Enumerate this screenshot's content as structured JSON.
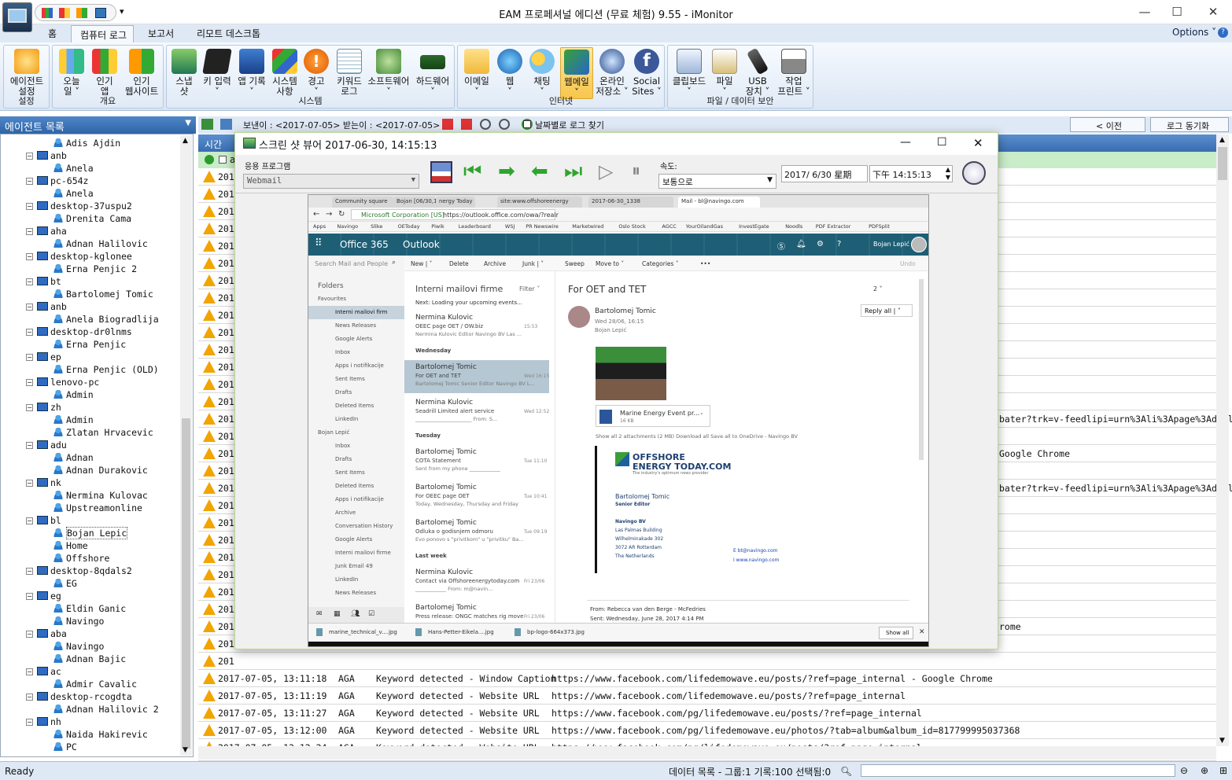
{
  "app": {
    "title": "EAM 프로페셔널 에디션 (무료 체험) 9.55 - iMonitor"
  },
  "window_controls": {
    "minimize": "—",
    "maximize": "☐",
    "close": "✕"
  },
  "ribbon_tabs": [
    "홈",
    "컴퓨터 로그",
    "보고서",
    "리모트 데스크톱"
  ],
  "options": "Options ˅",
  "groups": [
    {
      "label": "설정",
      "buttons": [
        "에이전트\n설정"
      ]
    },
    {
      "label": "개요",
      "buttons": [
        "오늘\n일 ˅",
        "인기\n앱",
        "인기\n웹사이트"
      ]
    },
    {
      "label": "시스템",
      "buttons": [
        "스냅\n샷",
        "키 입력\n˅",
        "앱 기록\n˅",
        "시스템\n사항",
        "경고\n˅",
        "키워드\n로그",
        "소프트웨어\n˅",
        "하드웨어\n˅"
      ]
    },
    {
      "label": "인터넷",
      "buttons": [
        "이메일\n˅",
        "웹\n˅",
        "채팅\n˅",
        "웹메일\n˅",
        "온라인\n저장소 ˅",
        "Social\nSites ˅"
      ]
    },
    {
      "label": "파일 / 데이터 보안",
      "buttons": [
        "클립보드\n˅",
        "파일\n˅",
        "USB\n장치 ˅",
        "작업\n프린트 ˅"
      ]
    }
  ],
  "agent_list": {
    "title": "에이전트 목록"
  },
  "tree": [
    {
      "t": "Adis Ajdin",
      "l": 2
    },
    {
      "t": "anb",
      "l": 1
    },
    {
      "t": "Anela",
      "l": 2
    },
    {
      "t": "pc-654z",
      "l": 1
    },
    {
      "t": "Anela",
      "l": 2
    },
    {
      "t": "desktop-37uspu2",
      "l": 1
    },
    {
      "t": "Drenita Cama",
      "l": 2
    },
    {
      "t": "aha",
      "l": 1
    },
    {
      "t": "Adnan Halilovic",
      "l": 2
    },
    {
      "t": "desktop-kglonee",
      "l": 1
    },
    {
      "t": "Erna Penjic 2",
      "l": 2
    },
    {
      "t": "bt",
      "l": 1
    },
    {
      "t": "Bartolomej Tomic",
      "l": 2
    },
    {
      "t": "anb",
      "l": 1
    },
    {
      "t": "Anela Biogradlija",
      "l": 2
    },
    {
      "t": "desktop-dr0lnms",
      "l": 1
    },
    {
      "t": "Erna Penjic",
      "l": 2
    },
    {
      "t": "ep",
      "l": 1
    },
    {
      "t": "Erna Penjic (OLD)",
      "l": 2
    },
    {
      "t": "lenovo-pc",
      "l": 1
    },
    {
      "t": "Admin",
      "l": 2
    },
    {
      "t": "zh",
      "l": 1
    },
    {
      "t": "Admin",
      "l": 2
    },
    {
      "t": "Zlatan Hrvacevic",
      "l": 2
    },
    {
      "t": "adu",
      "l": 1
    },
    {
      "t": "Adnan",
      "l": 2
    },
    {
      "t": "Adnan Durakovic",
      "l": 2
    },
    {
      "t": "nk",
      "l": 1
    },
    {
      "t": "Nermina Kulovac",
      "l": 2
    },
    {
      "t": "Upstreamonline",
      "l": 2
    },
    {
      "t": "bl",
      "l": 1
    },
    {
      "t": "Bojan Lepic",
      "l": 2
    },
    {
      "t": "Home",
      "l": 2
    },
    {
      "t": "Offshore",
      "l": 2
    },
    {
      "t": "desktop-8qdals2",
      "l": 1
    },
    {
      "t": "EG",
      "l": 2
    },
    {
      "t": "eg",
      "l": 1
    },
    {
      "t": "Eldin Ganic",
      "l": 2
    },
    {
      "t": "Navingo",
      "l": 2
    },
    {
      "t": "aba",
      "l": 1
    },
    {
      "t": "Navingo",
      "l": 2
    },
    {
      "t": "Adnan Bajic",
      "l": 2
    },
    {
      "t": "ac",
      "l": 1
    },
    {
      "t": "Admir Cavalic",
      "l": 2
    },
    {
      "t": "desktop-rcogdta",
      "l": 1
    },
    {
      "t": "Adnan Halilovic 2",
      "l": 2
    },
    {
      "t": "nh",
      "l": 1
    },
    {
      "t": "Naida Hakirevic",
      "l": 2
    },
    {
      "t": "PC",
      "l": 2
    }
  ],
  "toolbar2": {
    "range": "보낸이 : <2017-07-05> 받는이 : <2017-07-05>",
    "find_by_date": "날짜별로 로그 찾기",
    "prev": "< 이전",
    "sync": "로그 동기화"
  },
  "grid": {
    "time_header": "시간",
    "green_row": "a"
  },
  "partial_rows": [
    {
      "d": "201"
    },
    {
      "d": "201"
    },
    {
      "d": "201"
    },
    {
      "d": "201"
    },
    {
      "d": "201"
    },
    {
      "d": "201"
    },
    {
      "d": "201"
    },
    {
      "d": "201"
    },
    {
      "d": "201"
    },
    {
      "d": "201"
    },
    {
      "d": "201"
    },
    {
      "d": "201"
    },
    {
      "d": "201"
    },
    {
      "d": "201"
    },
    {
      "d": "201",
      "r": "bater?trk=v-feedlipi=urn%3Ali%3Apage%3Ad_flagsl"
    },
    {
      "d": "201"
    },
    {
      "d": "201",
      "r": "Google Chrome"
    },
    {
      "d": "201"
    },
    {
      "d": "201",
      "r": "bater?trk=v-feedlipi=urn%3Ali%3Apage%3Ad_flagsl"
    },
    {
      "d": "201"
    },
    {
      "d": "201"
    },
    {
      "d": "201"
    },
    {
      "d": "201"
    },
    {
      "d": "201"
    },
    {
      "d": "201"
    },
    {
      "d": "201"
    },
    {
      "d": "201",
      "r": "rome"
    },
    {
      "d": "201"
    },
    {
      "d": "201"
    }
  ],
  "rows": [
    {
      "time": "2017-07-05, 13:11:18",
      "user": "AGA",
      "type": "Keyword detected - Window Caption",
      "detail": "https://www.facebook.com/lifedemowave.eu/posts/?ref=page_internal - Google Chrome"
    },
    {
      "time": "2017-07-05, 13:11:19",
      "user": "AGA",
      "type": "Keyword detected - Website URL",
      "detail": "https://www.facebook.com/lifedemowave.eu/posts/?ref=page_internal"
    },
    {
      "time": "2017-07-05, 13:11:27",
      "user": "AGA",
      "type": "Keyword detected - Website URL",
      "detail": "https://www.facebook.com/pg/lifedemowave.eu/posts/?ref=page_internal"
    },
    {
      "time": "2017-07-05, 13:12:00",
      "user": "AGA",
      "type": "Keyword detected - Website URL",
      "detail": "https://www.facebook.com/pg/lifedemowave.eu/photos/?tab=album&album_id=817799995037368"
    },
    {
      "time": "2017-07-05, 13:12:24",
      "user": "AGA",
      "type": "Keyword detected - Website URL",
      "detail": "https://www.facebook.com/pg/lifedemowave.eu/posts/?ref=page_internal"
    }
  ],
  "status": {
    "left": "Ready",
    "right": "데이터 목록 - 그룹:1 기록:100 선택됨:0"
  },
  "viewer": {
    "title": "스크린 샷 뷰어 2017-06-30, 14:15:13",
    "app_label": "응용 프로그램",
    "app_value": "Webmail",
    "speed_label": "속도:",
    "speed_value": "보통으로",
    "date": "2017/ 6/30 星期",
    "time": "下午 14:15:13"
  },
  "shot": {
    "tabs": [
      "Community square",
      "Bojan [06/30,14:15:13]",
      "nergy Today",
      "site:www.offshoreenergy",
      "2017-06-30_1338",
      "Mail - bl@navingo.com"
    ],
    "url": "https://outlook.office.com/owa/?realr",
    "corp": "Microsoft Corporation [US]",
    "bookmarks": [
      "Apps",
      "Navingo",
      "Slike",
      "OEToday",
      "Piwik",
      "Leaderboard",
      "WSJ",
      "PR Newswire",
      "Marketwired",
      "Oslo Stock",
      "AGCC",
      "YourOilandGas",
      "InvestEgate",
      "Noodls",
      "PDF Extractor",
      "PDFSplit"
    ],
    "o365": "Office 365",
    "outlook": "Outlook",
    "user": "Bojan Lepić",
    "search": "Search Mail and People",
    "cmds": [
      "New | ˅",
      "Delete",
      "Archive",
      "Junk | ˅",
      "Sweep",
      "Move to ˅",
      "Categories ˅",
      "•••",
      "Undo"
    ],
    "folders": [
      "Folders",
      "Favourites",
      "Interni mailovi firm",
      "News Releases",
      "Google Alerts",
      "Inbox",
      "Apps i notifikacije",
      "Sent Items",
      "Drafts",
      "Deleted Items",
      "LinkedIn",
      "Bojan Lepić",
      "Inbox",
      "Drafts",
      "Sent Items",
      "Deleted Items",
      "Apps i notifikacije",
      "Archive",
      "Conversation History",
      "Google Alerts",
      "Interni mailovi firme",
      "Junk Email   49",
      "LinkedIn",
      "News Releases"
    ],
    "list_title": "Interni mailovi firme",
    "filter": "Filter ˅",
    "next": "Next: Loading your upcoming events...",
    "mails": [
      {
        "from": "Nermina Kulovic",
        "subj": "OEEC page OET / OW.biz",
        "prev": "Nermina Kulovic  Editor     Navingo BV  Las ...",
        "time": "15:53"
      },
      {
        "hdr": "Wednesday"
      },
      {
        "from": "Bartolomej Tomic",
        "subj": "For OET and TET",
        "prev": "Bartolomej Tomic Senior Editor    Navingo BV L...",
        "time": "Wed 16:15",
        "sel": true
      },
      {
        "from": "Nermina Kulovic",
        "subj": "Seadrill Limited alert service",
        "prev": "______________________  From: S...",
        "time": "Wed 12:52"
      },
      {
        "hdr": "Tuesday"
      },
      {
        "from": "Bartolomej Tomic",
        "subj": "COTA Statement",
        "prev": "Sent from my phone  ____________",
        "time": "Tue 11:10"
      },
      {
        "from": "Bartolomej Tomic",
        "subj": "For OEEC page OET",
        "prev": "Today, Wednesday, Thursday and Friday",
        "time": "Tue 10:41"
      },
      {
        "from": "Bartolomej Tomic",
        "subj": "Odluka o godisnjem odmoru",
        "prev": "Evo ponovo s \"privitkom\" u \"privitku\"     Ba...",
        "time": "Tue 09:19"
      },
      {
        "hdr": "Last week"
      },
      {
        "from": "Nermina Kulovic",
        "subj": "Contact via Offshoreenergytoday.com",
        "prev": "____________  From: m@navin...",
        "time": "Fri 23/06"
      },
      {
        "from": "Bartolomej Tomic",
        "subj": "Press release: ONGC matches rig move",
        "prev": "",
        "time": "Fri 23/06"
      }
    ],
    "read": {
      "subject": "For OET and TET",
      "from": "Bartolomej Tomic",
      "date": "Wed 28/06, 16:15",
      "to": "Bojan Lepić",
      "count": "2 ˅",
      "reply": "Reply all | ˅",
      "att_name": "Marine Energy Event pr...",
      "att_size": "16 KB",
      "att_links": "Show all 2 attachments (2 MB)    Download all    Save all to OneDrive - Navingo BV",
      "logo1": "OFFSHORE",
      "logo2": "ENERGY TODAY.COM",
      "logo_tag": "The industry's optimum news provider",
      "sig": [
        "Bartolomej Tomic",
        "Senior Editor",
        "",
        "Navingo BV",
        "Las Palmas Building",
        "Wilhelminakade 302",
        "3072 AR Rotterdam",
        "The Netherlands"
      ],
      "sig_e": "E  bt@navingo.com",
      "sig_i": "I   www.navingo.com",
      "from2": "From: Rebecca van den Berge - McFedries",
      "sent2": "Sent: Wednesday, June 28, 2017 4:14 PM"
    },
    "downloads": [
      "marine_technical_v....jpg",
      "Hans-Petter-Eikela....jpg",
      "bp-logo-664x373.jpg"
    ],
    "show_all": "Show all"
  },
  "colors": {
    "ribbon_bg": "#dfe9f5",
    "header_blue": "#3a6db0",
    "warn": "#f2a400",
    "o365": "#1e5f76"
  }
}
